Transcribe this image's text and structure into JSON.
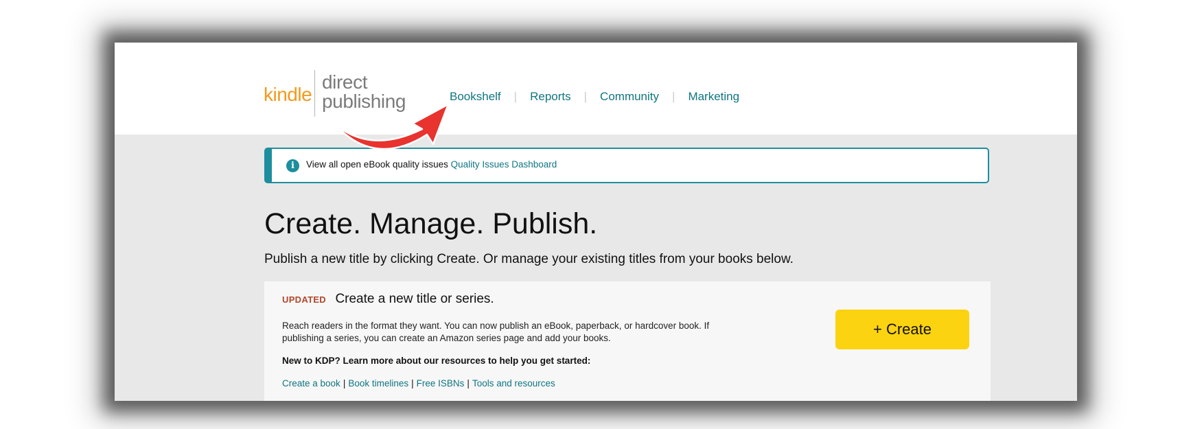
{
  "logo": {
    "kindle": "kindle",
    "direct": "direct",
    "publishing": "publishing"
  },
  "nav": {
    "items": [
      "Bookshelf",
      "Reports",
      "Community",
      "Marketing"
    ],
    "separator": "|"
  },
  "notice": {
    "text": "View all open eBook quality issues",
    "link": "Quality Issues Dashboard",
    "icon": "info-icon"
  },
  "headline": "Create. Manage. Publish.",
  "subline": "Publish a new title by clicking Create. Or manage your existing titles from your books below.",
  "card": {
    "badge": "UPDATED",
    "title": "Create a new title or series.",
    "description": "Reach readers in the format they want. You can now publish an eBook, paperback, or hardcover book. If publishing a series, you can create an Amazon series page and add your books.",
    "resources_heading": "New to KDP? Learn more about our resources to help you get started:",
    "links": [
      "Create a book",
      "Book timelines",
      "Free ISBNs",
      "Tools and resources"
    ],
    "link_separator": "|",
    "create_button": "+ Create"
  },
  "annotation": {
    "icon": "red-curved-arrow-icon",
    "color": "#e8332e"
  },
  "colors": {
    "link": "#0f7581",
    "accent_border": "#1d8e9d",
    "logo_orange": "#f29a1c",
    "button_yellow": "#fcd310",
    "badge_red": "#b1462a"
  }
}
